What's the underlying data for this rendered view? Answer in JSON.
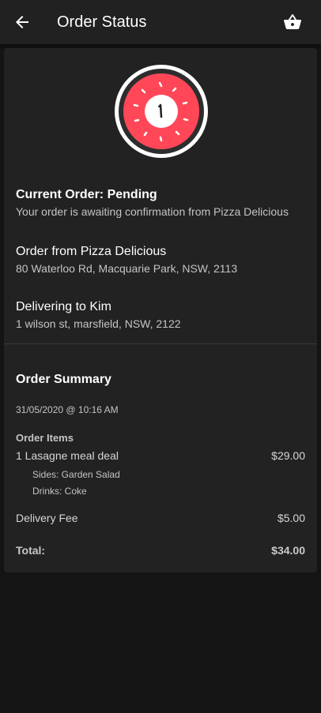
{
  "header": {
    "title": "Order Status"
  },
  "status": {
    "headline": "Current Order: Pending",
    "message": "Your order is awaiting confirmation from Pizza Delicious"
  },
  "restaurant": {
    "heading": "Order from Pizza Delicious",
    "address": "80 Waterloo Rd, Macquarie Park, NSW, 2113"
  },
  "delivery": {
    "heading": "Delivering to Kim",
    "address": "1 wilson st, marsfield, NSW, 2122"
  },
  "summary": {
    "title": "Order Summary",
    "date": "31/05/2020 @ 10:16 AM",
    "items_label": "Order Items",
    "items": [
      {
        "name": "1 Lasagne meal deal",
        "price": "$29.00",
        "details": [
          "Sides: Garden Salad",
          "Drinks: Coke"
        ]
      }
    ],
    "delivery_fee_label": "Delivery Fee",
    "delivery_fee": "$5.00",
    "total_label": "Total:",
    "total": "$34.00"
  },
  "colors": {
    "accent": "#ff4757",
    "background": "#141414",
    "card": "#222222",
    "app_bar": "#212121"
  },
  "icons": {
    "back": "arrow-left-icon",
    "basket": "shopping-basket-icon",
    "status": "donut-clock-icon"
  }
}
